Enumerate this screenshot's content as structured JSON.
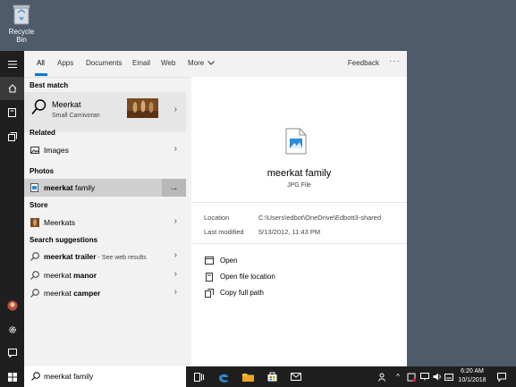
{
  "desktop": {
    "recycle_bin_label": "Recycle Bin"
  },
  "tabs": [
    {
      "label": "All",
      "active": true
    },
    {
      "label": "Apps"
    },
    {
      "label": "Documents"
    },
    {
      "label": "Email"
    },
    {
      "label": "Web"
    },
    {
      "label": "More"
    }
  ],
  "feedback_label": "Feedback",
  "more_options_label": "···",
  "sections": {
    "best_match": "Best match",
    "related": "Related",
    "photos": "Photos",
    "store": "Store",
    "search_suggestions": "Search suggestions"
  },
  "best_match": {
    "title": "Meerkat",
    "subtitle": "Small Carnivoran"
  },
  "related": {
    "label": "Images"
  },
  "photos": {
    "label_bold": "meerkat",
    "label_rest": " family"
  },
  "store": {
    "label": "Meerkats"
  },
  "suggestions": [
    {
      "bold": "meerkat trailer",
      "rest": " - See web results"
    },
    {
      "bold": "meerkat",
      "rest_bold": " manor"
    },
    {
      "bold": "meerkat",
      "rest_bold": " camper"
    }
  ],
  "preview": {
    "title": "meerkat family",
    "subtitle": "JPG File",
    "location_label": "Location",
    "location_value": "C:\\Users\\edbot\\OneDrive\\Edbott3-shared",
    "modified_label": "Last modified",
    "modified_value": "5/13/2012, 11:43 PM",
    "actions": [
      "Open",
      "Open file location",
      "Copy full path"
    ]
  },
  "search": {
    "value": "meerkat family"
  },
  "clock": {
    "time": "6:20 AM",
    "date": "10/1/2018"
  },
  "colors": {
    "accent": "#0078d7",
    "taskbar": "#1f1f1f",
    "desktop": "#4f5a6a"
  }
}
